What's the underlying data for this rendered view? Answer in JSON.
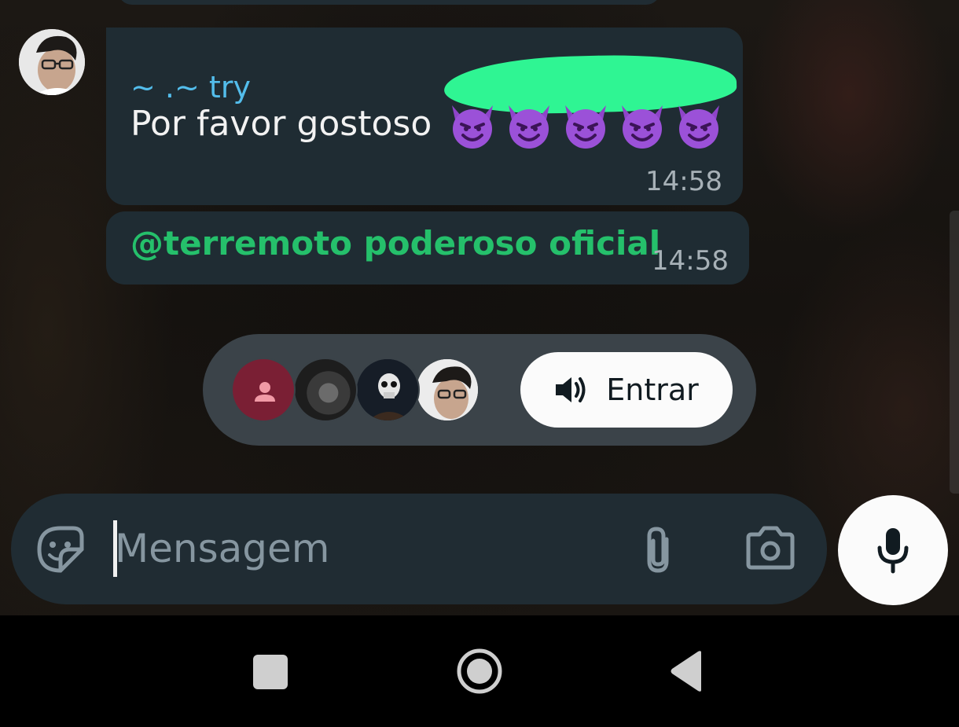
{
  "chat": {
    "messages": [
      {
        "sender": "~ .~ try",
        "text": "Por favor gostoso",
        "emoji": "smiling-face-with-horns",
        "emoji_count": 5,
        "time": "14:58"
      },
      {
        "mention": "@terremoto poderoso oficial",
        "time": "14:58"
      }
    ],
    "sender_name_color": "#53bdeb",
    "mention_color": "#25c06b",
    "bubble_color": "#1f2c33"
  },
  "voice_chat": {
    "join_label": "Entrar",
    "join_icon": "speaker-icon",
    "participant_count_shown": 4
  },
  "composer": {
    "placeholder": "Mensagem",
    "sticker_icon": "sticker-icon",
    "attach_icon": "paperclip-icon",
    "camera_icon": "camera-icon",
    "mic_icon": "microphone-icon"
  },
  "nav_bar": {
    "recents_icon": "square-icon",
    "home_icon": "circle-icon",
    "back_icon": "triangle-back-icon"
  }
}
